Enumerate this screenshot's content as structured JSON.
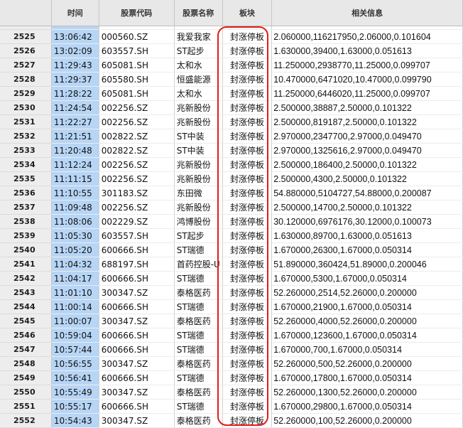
{
  "columns": [
    "",
    "时间",
    "股票代码",
    "股票名称",
    "板块",
    "相关信息"
  ],
  "rows": [
    {
      "id": "2525",
      "time": "13:06:42",
      "code": "000560.SZ",
      "name": "我爱我家",
      "sector": "封涨停板",
      "info": "2.060000,116217950,2.06000,0.101604"
    },
    {
      "id": "2526",
      "time": "13:02:09",
      "code": "603557.SH",
      "name": "ST起步",
      "sector": "封涨停板",
      "info": "1.630000,39400,1.63000,0.051613"
    },
    {
      "id": "2527",
      "time": "11:29:43",
      "code": "605081.SH",
      "name": "太和水",
      "sector": "封涨停板",
      "info": "11.250000,2938770,11.25000,0.099707"
    },
    {
      "id": "2528",
      "time": "11:29:37",
      "code": "605580.SH",
      "name": "恒盛能源",
      "sector": "封涨停板",
      "info": "10.470000,6471020,10.47000,0.099790"
    },
    {
      "id": "2529",
      "time": "11:28:22",
      "code": "605081.SH",
      "name": "太和水",
      "sector": "封涨停板",
      "info": "11.250000,6446020,11.25000,0.099707"
    },
    {
      "id": "2530",
      "time": "11:24:54",
      "code": "002256.SZ",
      "name": "兆新股份",
      "sector": "封涨停板",
      "info": "2.500000,38887,2.50000,0.101322"
    },
    {
      "id": "2531",
      "time": "11:22:27",
      "code": "002256.SZ",
      "name": "兆新股份",
      "sector": "封涨停板",
      "info": "2.500000,819187,2.50000,0.101322"
    },
    {
      "id": "2532",
      "time": "11:21:51",
      "code": "002822.SZ",
      "name": "ST中装",
      "sector": "封涨停板",
      "info": "2.970000,2347700,2.97000,0.049470"
    },
    {
      "id": "2533",
      "time": "11:20:48",
      "code": "002822.SZ",
      "name": "ST中装",
      "sector": "封涨停板",
      "info": "2.970000,1325616,2.97000,0.049470"
    },
    {
      "id": "2534",
      "time": "11:12:24",
      "code": "002256.SZ",
      "name": "兆新股份",
      "sector": "封涨停板",
      "info": "2.500000,186400,2.50000,0.101322"
    },
    {
      "id": "2535",
      "time": "11:11:15",
      "code": "002256.SZ",
      "name": "兆新股份",
      "sector": "封涨停板",
      "info": "2.500000,4300,2.50000,0.101322"
    },
    {
      "id": "2536",
      "time": "11:10:55",
      "code": "301183.SZ",
      "name": "东田微",
      "sector": "封涨停板",
      "info": "54.880000,5104727,54.88000,0.200087"
    },
    {
      "id": "2537",
      "time": "11:09:48",
      "code": "002256.SZ",
      "name": "兆新股份",
      "sector": "封涨停板",
      "info": "2.500000,14700,2.50000,0.101322"
    },
    {
      "id": "2538",
      "time": "11:08:06",
      "code": "002229.SZ",
      "name": "鸿博股份",
      "sector": "封涨停板",
      "info": "30.120000,6976176,30.12000,0.100073"
    },
    {
      "id": "2539",
      "time": "11:05:30",
      "code": "603557.SH",
      "name": "ST起步",
      "sector": "封涨停板",
      "info": "1.630000,89700,1.63000,0.051613"
    },
    {
      "id": "2540",
      "time": "11:05:20",
      "code": "600666.SH",
      "name": "ST瑞德",
      "sector": "封涨停板",
      "info": "1.670000,26300,1.67000,0.050314"
    },
    {
      "id": "2541",
      "time": "11:04:32",
      "code": "688197.SH",
      "name": "首药控股-U",
      "sector": "封涨停板",
      "info": "51.890000,360424,51.89000,0.200046"
    },
    {
      "id": "2542",
      "time": "11:04:17",
      "code": "600666.SH",
      "name": "ST瑞德",
      "sector": "封涨停板",
      "info": "1.670000,5300,1.67000,0.050314"
    },
    {
      "id": "2543",
      "time": "11:01:10",
      "code": "300347.SZ",
      "name": "泰格医药",
      "sector": "封涨停板",
      "info": "52.260000,2514,52.26000,0.200000"
    },
    {
      "id": "2544",
      "time": "11:00:14",
      "code": "600666.SH",
      "name": "ST瑞德",
      "sector": "封涨停板",
      "info": "1.670000,21900,1.67000,0.050314"
    },
    {
      "id": "2545",
      "time": "11:00:07",
      "code": "300347.SZ",
      "name": "泰格医药",
      "sector": "封涨停板",
      "info": "52.260000,4000,52.26000,0.200000"
    },
    {
      "id": "2546",
      "time": "10:59:04",
      "code": "600666.SH",
      "name": "ST瑞德",
      "sector": "封涨停板",
      "info": "1.670000,123600,1.67000,0.050314"
    },
    {
      "id": "2547",
      "time": "10:57:44",
      "code": "600666.SH",
      "name": "ST瑞德",
      "sector": "封涨停板",
      "info": "1.670000,700,1.67000,0.050314"
    },
    {
      "id": "2548",
      "time": "10:56:55",
      "code": "300347.SZ",
      "name": "泰格医药",
      "sector": "封涨停板",
      "info": "52.260000,500,52.26000,0.200000"
    },
    {
      "id": "2549",
      "time": "10:56:41",
      "code": "600666.SH",
      "name": "ST瑞德",
      "sector": "封涨停板",
      "info": "1.670000,17800,1.67000,0.050314"
    },
    {
      "id": "2550",
      "time": "10:55:49",
      "code": "300347.SZ",
      "name": "泰格医药",
      "sector": "封涨停板",
      "info": "52.260000,1300,52.26000,0.200000"
    },
    {
      "id": "2551",
      "time": "10:55:17",
      "code": "600666.SH",
      "name": "ST瑞德",
      "sector": "封涨停板",
      "info": "1.670000,29800,1.67000,0.050314"
    },
    {
      "id": "2552",
      "time": "10:54:43",
      "code": "300347.SZ",
      "name": "泰格医药",
      "sector": "封涨停板",
      "info": "52.260000,100,52.26000,0.200000"
    }
  ],
  "colors": {
    "time_highlight": "#b7d5f5",
    "annotation_ring": "#e31b1b",
    "header_bg": "#e8e8e8"
  }
}
